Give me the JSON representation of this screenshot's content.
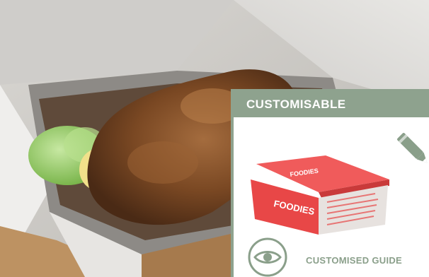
{
  "panel": {
    "title": "CUSTOMISABLE",
    "box_brand": "FOODIES",
    "guide_label": "CUSTOMISED GUIDE"
  },
  "icons": [
    "pencil-icon",
    "eye-icon"
  ],
  "colors": {
    "accent_sage": "#8ea28e",
    "box_red": "#e84747",
    "guide_text": "#8a9f8a"
  }
}
